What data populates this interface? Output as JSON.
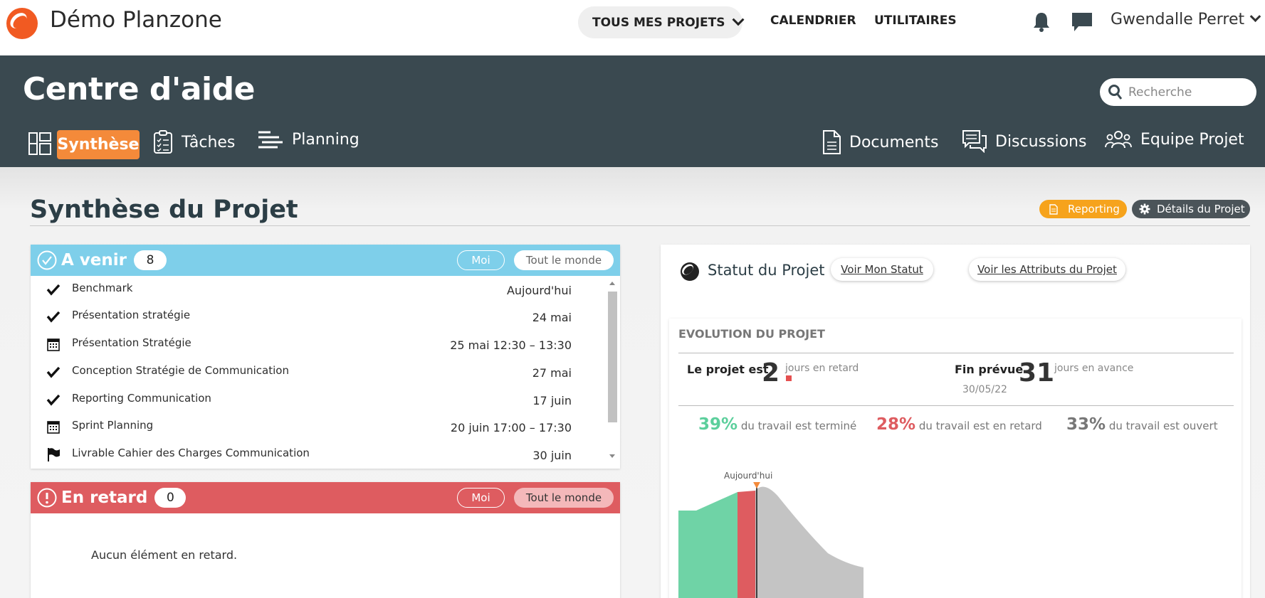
{
  "app": {
    "title": "Démo Planzone"
  },
  "topnav": {
    "projects_label": "TOUS MES PROJETS",
    "calendar_label": "CALENDRIER",
    "utilities_label": "UTILITAIRES",
    "user_name": "Gwendalle Perret"
  },
  "header": {
    "title": "Centre d'aide",
    "search_placeholder": "Recherche",
    "tabs": {
      "synthese": "Synthèse",
      "taches": "Tâches",
      "planning": "Planning",
      "documents": "Documents",
      "discussions": "Discussions",
      "equipe": "Equipe Projet"
    }
  },
  "synthese": {
    "title": "Synthèse du Projet",
    "reporting_label": "Reporting",
    "details_label": "Détails du Projet"
  },
  "upcoming": {
    "title": "A venir",
    "count": "8",
    "filter_me": "Moi",
    "filter_all": "Tout le monde",
    "items": [
      {
        "icon": "check-icon",
        "name": "Benchmark",
        "date": "Aujourd'hui"
      },
      {
        "icon": "check-icon",
        "name": "Présentation stratégie",
        "date": "24 mai"
      },
      {
        "icon": "calendar-icon",
        "name": "Présentation Stratégie",
        "date": "25 mai 12:30 – 13:30"
      },
      {
        "icon": "check-icon",
        "name": "Conception Stratégie de Communication",
        "date": "27 mai"
      },
      {
        "icon": "check-icon",
        "name": "Reporting Communication",
        "date": "17 juin"
      },
      {
        "icon": "calendar-icon",
        "name": "Sprint Planning",
        "date": "20 juin 17:00 – 17:30"
      },
      {
        "icon": "flag-icon",
        "name": "Livrable Cahier des Charges Communication",
        "date": "30 juin"
      }
    ]
  },
  "late": {
    "title": "En retard",
    "count": "0",
    "filter_me": "Moi",
    "filter_all": "Tout le monde",
    "empty_text": "Aucun élément en retard."
  },
  "status": {
    "title": "Statut du Projet",
    "my_status_label": "Voir Mon Statut",
    "attributes_label": "Voir les Attributs du Projet",
    "evolution": {
      "heading": "EVOLUTION DU PROJET",
      "project_is_label": "Le projet est",
      "late_days": "2",
      "late_days_suffix": "jours en retard",
      "planned_end_label": "Fin prévue",
      "planned_end_date": "30/05/22",
      "ahead_days": "31",
      "ahead_days_suffix": "jours en avance",
      "done_pct": "39%",
      "done_text": "du travail est terminé",
      "late_pct": "28%",
      "late_text": "du travail est en retard",
      "open_pct": "33%",
      "open_text": "du travail est ouvert",
      "today_label": "Aujourd'hui"
    }
  },
  "colors": {
    "header_bg": "#3a4950",
    "accent_orange": "#f48a3a",
    "upcoming_blue": "#7ecfea",
    "late_red": "#de5c60",
    "done_green": "#6fd3a6",
    "reporting_yellow": "#f6a31c"
  }
}
